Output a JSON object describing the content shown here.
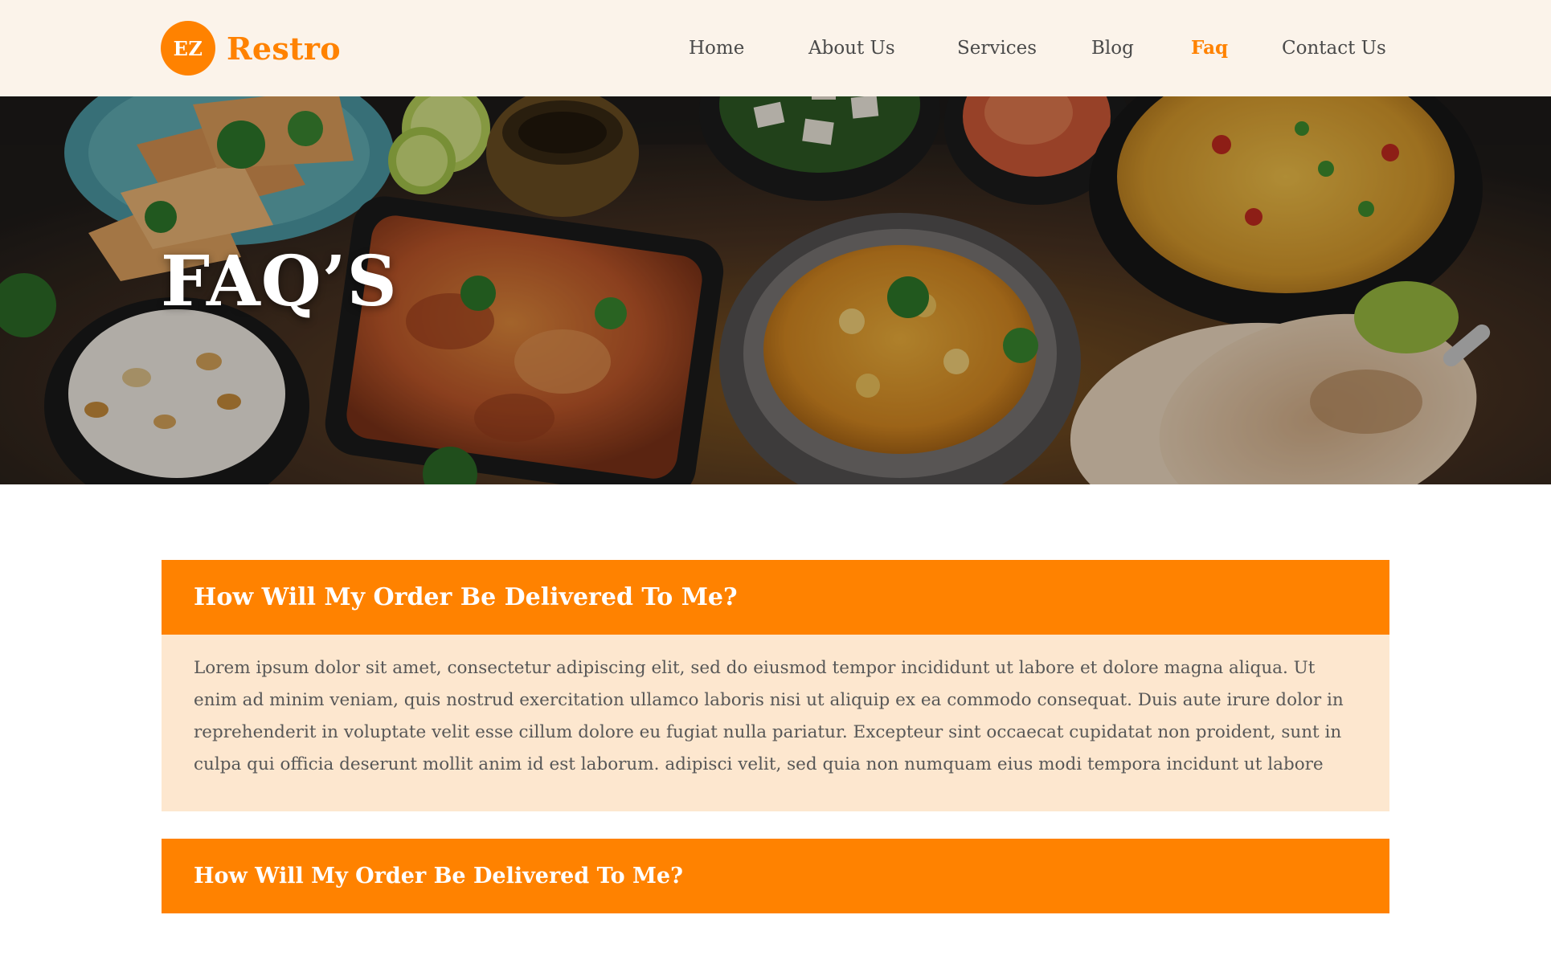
{
  "brand": {
    "badge": "EZ",
    "name": "Restro",
    "accent_color": "#ff8200",
    "header_bg": "#fbf3ea"
  },
  "nav": {
    "items": [
      {
        "label": "Home",
        "active": false
      },
      {
        "label": "About Us",
        "active": false
      },
      {
        "label": "Services",
        "active": false
      },
      {
        "label": "Blog",
        "active": false
      },
      {
        "label": "Faq",
        "active": true
      },
      {
        "label": "Contact Us",
        "active": false
      }
    ]
  },
  "hero": {
    "title": "FAQ’S",
    "image": "assorted-indian-food-dishes-photo"
  },
  "faq": {
    "items": [
      {
        "question": "How Will My Order Be Delivered To Me?",
        "answer": "Lorem ipsum dolor sit amet, consectetur adipiscing elit, sed do eiusmod tempor incididunt ut labore et dolore magna aliqua. Ut enim ad minim veniam, quis nostrud exercitation ullamco laboris nisi ut aliquip ex ea commodo consequat. Duis aute irure dolor in reprehenderit in voluptate velit esse cillum dolore eu fugiat nulla pariatur. Excepteur sint occaecat cupidatat non proident, sunt in culpa qui officia deserunt mollit anim id est laborum. adipisci velit, sed quia non numquam eius modi tempora incidunt ut labore",
        "expanded": true
      },
      {
        "question": "How Will My Order Be Delivered To Me?",
        "expanded": false
      }
    ],
    "question_bg": "#ff8200",
    "answer_bg": "#fde7cf"
  }
}
